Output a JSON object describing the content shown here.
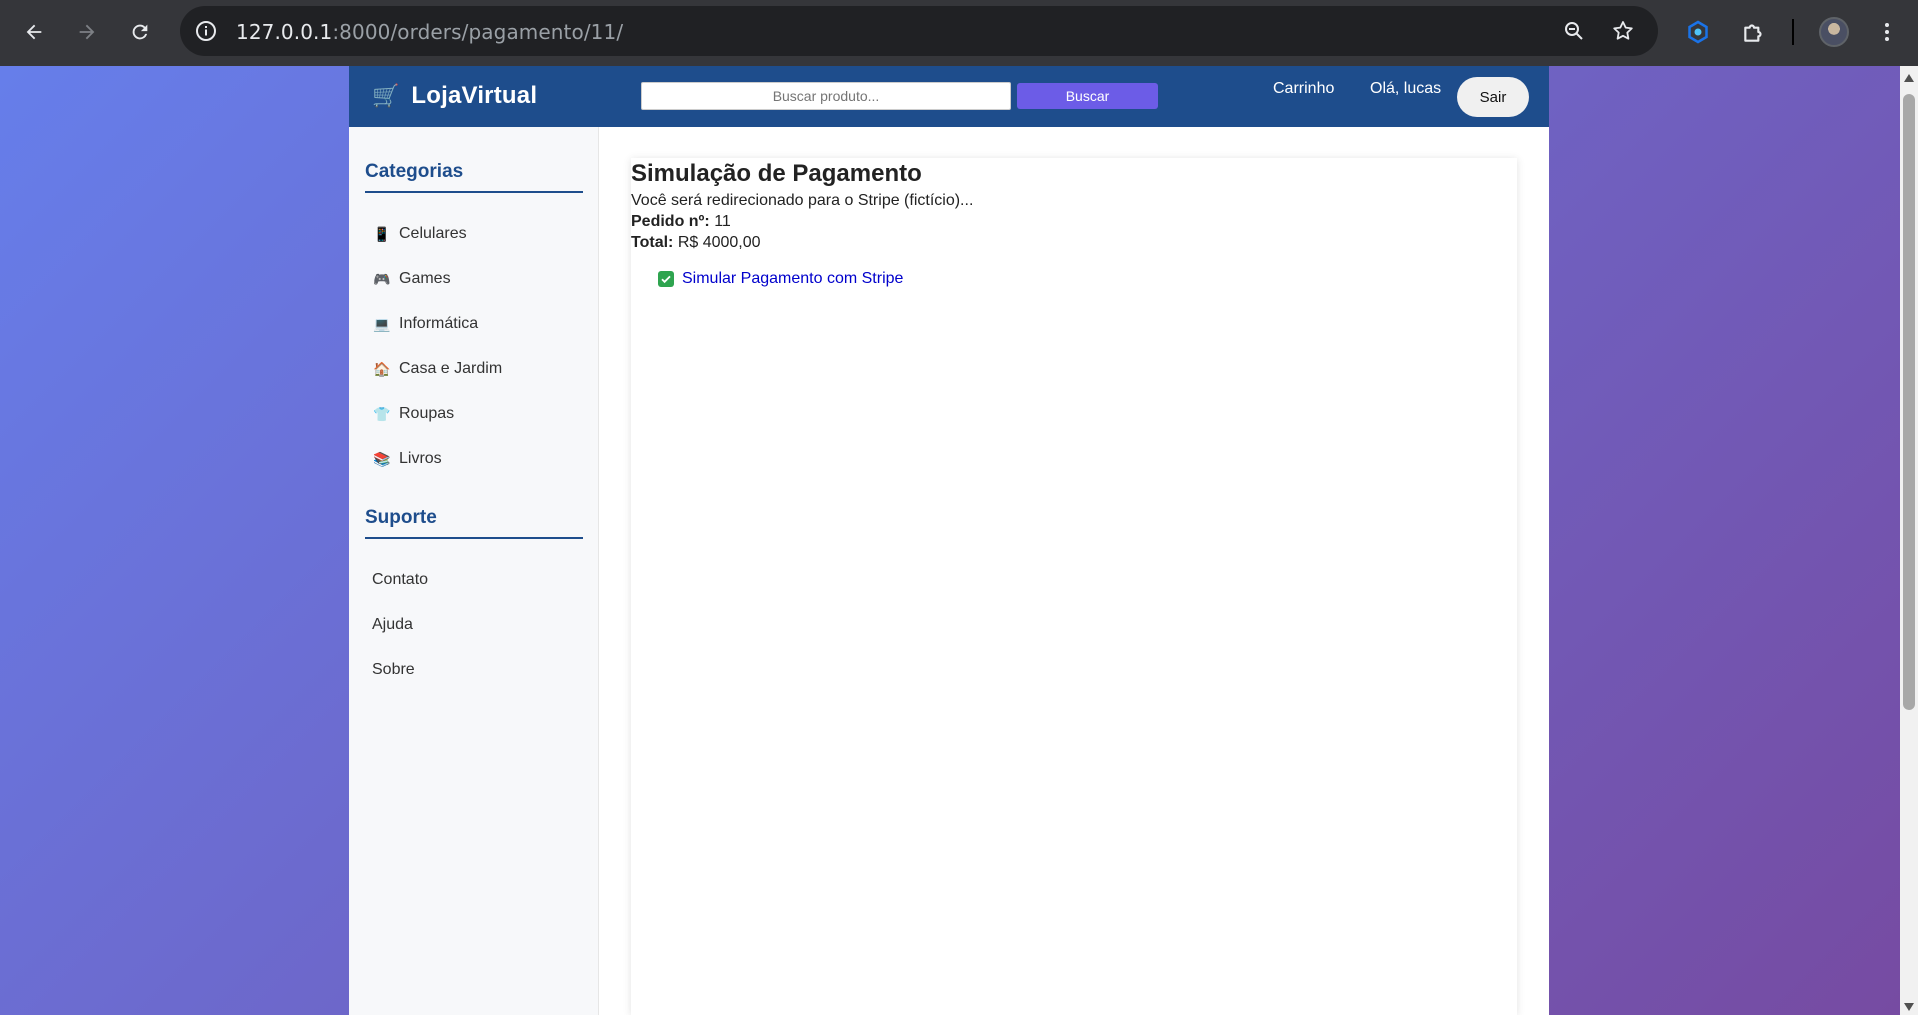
{
  "browser": {
    "url_host": "127.0.0.1",
    "url_rest": ":8000/orders/pagamento/11/"
  },
  "header": {
    "logo_text": "LojaVirtual",
    "search_placeholder": "Buscar produto...",
    "search_button": "Buscar",
    "cart_link": "Carrinho",
    "greeting": "Olá, lucas",
    "logout_button": "Sair"
  },
  "sidebar": {
    "categories_title": "Categorias",
    "categories": [
      {
        "emoji": "📱",
        "label": "Celulares"
      },
      {
        "emoji": "🎮",
        "label": "Games"
      },
      {
        "emoji": "💻",
        "label": "Informática"
      },
      {
        "emoji": "🏠",
        "label": "Casa e Jardim"
      },
      {
        "emoji": "👕",
        "label": "Roupas"
      },
      {
        "emoji": "📚",
        "label": "Livros"
      }
    ],
    "support_title": "Suporte",
    "support": [
      {
        "label": "Contato"
      },
      {
        "label": "Ajuda"
      },
      {
        "label": "Sobre"
      }
    ]
  },
  "main": {
    "title": "Simulação de Pagamento",
    "subtitle": "Você será redirecionado para o Stripe (fictício)...",
    "order_label": "Pedido nº:",
    "order_value": "11",
    "total_label": "Total:",
    "total_value": "R$ 4000,00",
    "pay_link": "Simular Pagamento com Stripe"
  },
  "colors": {
    "header_bg": "#1e4d8c",
    "search_button_bg": "#6c5ce7",
    "gradient_start": "#667eea",
    "gradient_end": "#764ba2",
    "link": "#0000cc"
  }
}
